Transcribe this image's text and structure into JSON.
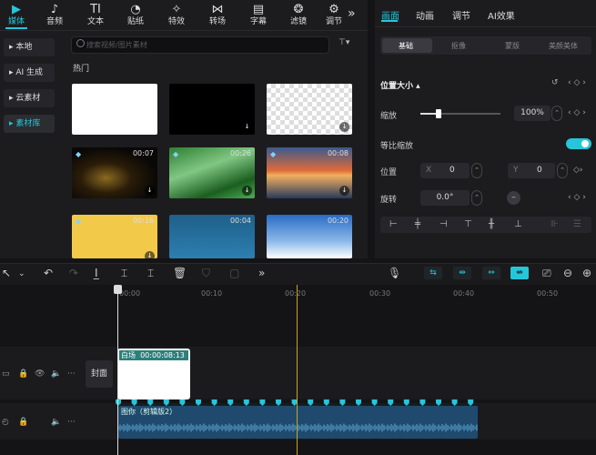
{
  "toolbar": {
    "items": [
      {
        "label": "媒体",
        "icon": "media-icon",
        "glyph": "▶"
      },
      {
        "label": "音频",
        "icon": "audio-icon",
        "glyph": "♪"
      },
      {
        "label": "文本",
        "icon": "text-icon",
        "glyph": "TI"
      },
      {
        "label": "贴纸",
        "icon": "sticker-icon",
        "glyph": "◔"
      },
      {
        "label": "特效",
        "icon": "effects-icon",
        "glyph": "✧"
      },
      {
        "label": "转场",
        "icon": "transition-icon",
        "glyph": "⋈"
      },
      {
        "label": "字幕",
        "icon": "subtitle-icon",
        "glyph": "▤"
      },
      {
        "label": "滤镜",
        "icon": "filter-icon",
        "glyph": "❂"
      },
      {
        "label": "调节",
        "icon": "adjust-icon",
        "glyph": "⚙"
      }
    ],
    "more": "»"
  },
  "sidebar": {
    "items": [
      {
        "label": "▸ 本地"
      },
      {
        "label": "▸ AI 生成"
      },
      {
        "label": "▸ 云素材"
      },
      {
        "label": "▸ 素材库"
      }
    ]
  },
  "media": {
    "search_placeholder": "搜索视频/图片素材",
    "filter": "⊤▾",
    "section": "热门",
    "thumbs": [
      {
        "duration": "",
        "style": "white"
      },
      {
        "duration": "",
        "style": "black",
        "download": true
      },
      {
        "duration": "",
        "style": "checker",
        "download": true
      },
      {
        "duration": "00:07",
        "style": "sparkle",
        "download": true,
        "vip": true
      },
      {
        "duration": "00:26",
        "style": "forest",
        "download": true,
        "vip": true
      },
      {
        "duration": "00:08",
        "style": "sunset",
        "download": true,
        "vip": true
      },
      {
        "duration": "00:16",
        "style": "yellow",
        "download": true,
        "vip": true
      },
      {
        "duration": "00:04",
        "style": "bluetext",
        "download": true
      },
      {
        "duration": "00:20",
        "style": "sky",
        "download": true
      }
    ]
  },
  "panel": {
    "tabs": [
      "画面",
      "动画",
      "调节",
      "AI效果"
    ],
    "subtabs": [
      "基础",
      "抠像",
      "蒙版",
      "美颜美体"
    ],
    "position_size": "位置大小 ▴",
    "scale_label": "缩放",
    "scale_value": "100%",
    "uniform_label": "等比缩放",
    "position_label": "位置",
    "x_label": "X",
    "x_value": "0",
    "y_label": "Y",
    "y_value": "0",
    "rotate_label": "旋转",
    "rotate_value": "0.0°",
    "keyframe": "‹ ◇ ›"
  },
  "timeline": {
    "ticks": [
      "00:00",
      "00:10",
      "00:20",
      "00:30",
      "00:40",
      "00:50"
    ],
    "cover_label": "封面",
    "clip_title": "白场",
    "clip_duration": "00:00:08:13",
    "audio_label": "图你（剪辑版2）"
  },
  "colors": {
    "accent": "#26c6da",
    "audio": "#1f4a6e",
    "playhead_marker": "#c9a227"
  }
}
